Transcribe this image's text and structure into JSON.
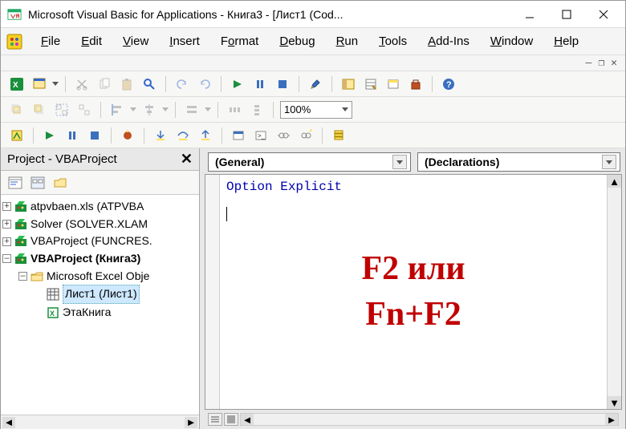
{
  "window": {
    "title": "Microsoft Visual Basic for Applications - Книга3 - [Лист1 (Cod..."
  },
  "menu": {
    "items": [
      {
        "u": "F",
        "rest": "ile"
      },
      {
        "u": "E",
        "rest": "dit"
      },
      {
        "u": "V",
        "rest": "iew"
      },
      {
        "u": "I",
        "rest": "nsert"
      },
      {
        "u": "F",
        "rest": "ormat",
        "ualt": "o",
        "pre": "F"
      },
      {
        "u": "D",
        "rest": "ebug"
      },
      {
        "u": "R",
        "rest": "un"
      },
      {
        "u": "T",
        "rest": "ools"
      },
      {
        "u": "A",
        "rest": "dd-Ins"
      },
      {
        "u": "W",
        "rest": "indow"
      },
      {
        "u": "H",
        "rest": "elp"
      }
    ]
  },
  "toolbars": {
    "zoom": "100%"
  },
  "project": {
    "panel_title": "Project - VBAProject",
    "nodes": [
      {
        "lvl": 1,
        "exp": "+",
        "icon": "vba",
        "label": "atpvbaen.xls (ATPVBA"
      },
      {
        "lvl": 1,
        "exp": "+",
        "icon": "vba",
        "label": "Solver (SOLVER.XLAM"
      },
      {
        "lvl": 1,
        "exp": "+",
        "icon": "vba",
        "label": "VBAProject (FUNCRES."
      },
      {
        "lvl": 1,
        "exp": "-",
        "icon": "vba",
        "label": "VBAProject (Книга3)",
        "bold": true
      },
      {
        "lvl": 2,
        "exp": "-",
        "icon": "folder",
        "label": "Microsoft Excel Obje"
      },
      {
        "lvl": 3,
        "exp": "",
        "icon": "sheet",
        "label": "Лист1 (Лист1)",
        "sel": true
      },
      {
        "lvl": 3,
        "exp": "",
        "icon": "book",
        "label": "ЭтаКнига"
      }
    ]
  },
  "code": {
    "object_dd": "(General)",
    "proc_dd": "(Declarations)",
    "line1": "Option Explicit"
  },
  "overlay": {
    "line1": "F2 или",
    "line2": "Fn+F2"
  }
}
